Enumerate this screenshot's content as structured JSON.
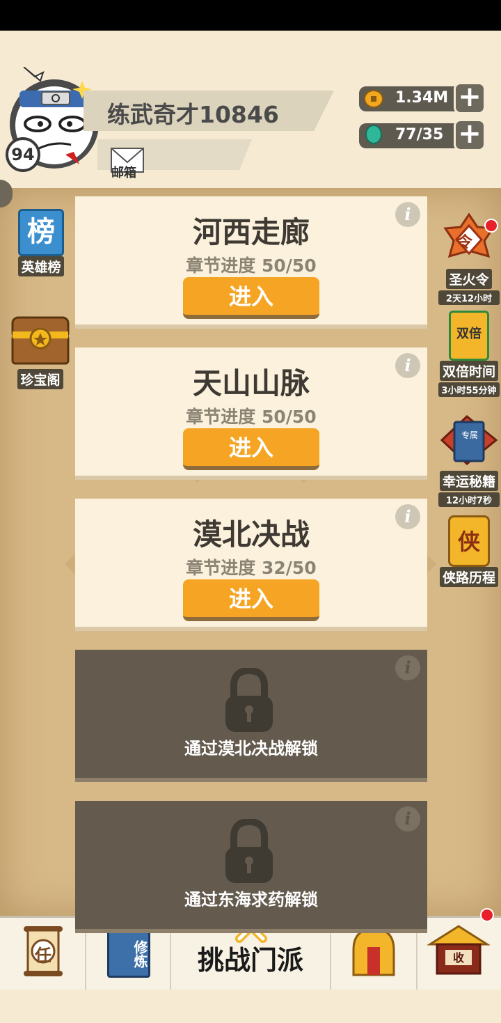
{
  "player": {
    "name": "练武奇才10846",
    "level": "94"
  },
  "mail": {
    "label": "邮箱"
  },
  "currencies": [
    {
      "icon": "coin-icon",
      "value": "1.34M"
    },
    {
      "icon": "energy-icon",
      "value": "77/35"
    }
  ],
  "left_sidebar": [
    {
      "icon": "ranking-icon",
      "icon_text": "榜",
      "label": "英雄榜"
    },
    {
      "icon": "treasure-chest-icon",
      "label": "珍宝阁"
    }
  ],
  "right_sidebar": [
    {
      "icon": "fire-token-icon",
      "icon_text": "令",
      "label": "圣火令",
      "sub": "2天12小时"
    },
    {
      "icon": "double-time-icon",
      "icon_text": "双倍",
      "label": "双倍时间",
      "sub": "3小时55分钟"
    },
    {
      "icon": "secret-book-icon",
      "icon_text": "专属",
      "label": "幸运秘籍",
      "sub": "12小时7秒"
    },
    {
      "icon": "hero-path-icon",
      "icon_text": "侠",
      "label": "侠路历程"
    }
  ],
  "chapters": [
    {
      "title": "河西走廊",
      "progress": "章节进度 50/50",
      "enter_label": "进入"
    },
    {
      "title": "天山山脉",
      "progress": "章节进度 50/50",
      "enter_label": "进入"
    },
    {
      "title": "漠北决战",
      "progress": "章节进度 32/50",
      "enter_label": "进入"
    }
  ],
  "locked_chapters": [
    {
      "unlock_text": "通过漠北决战解锁"
    },
    {
      "unlock_text": "通过东海求药解锁"
    }
  ],
  "bottom_nav": {
    "task_text": "任",
    "cultivate_text": "修炼",
    "challenge_label": "挑战门派",
    "shop_text": "收"
  },
  "colors": {
    "accent": "#f5a523",
    "badge": "#e8202a"
  }
}
